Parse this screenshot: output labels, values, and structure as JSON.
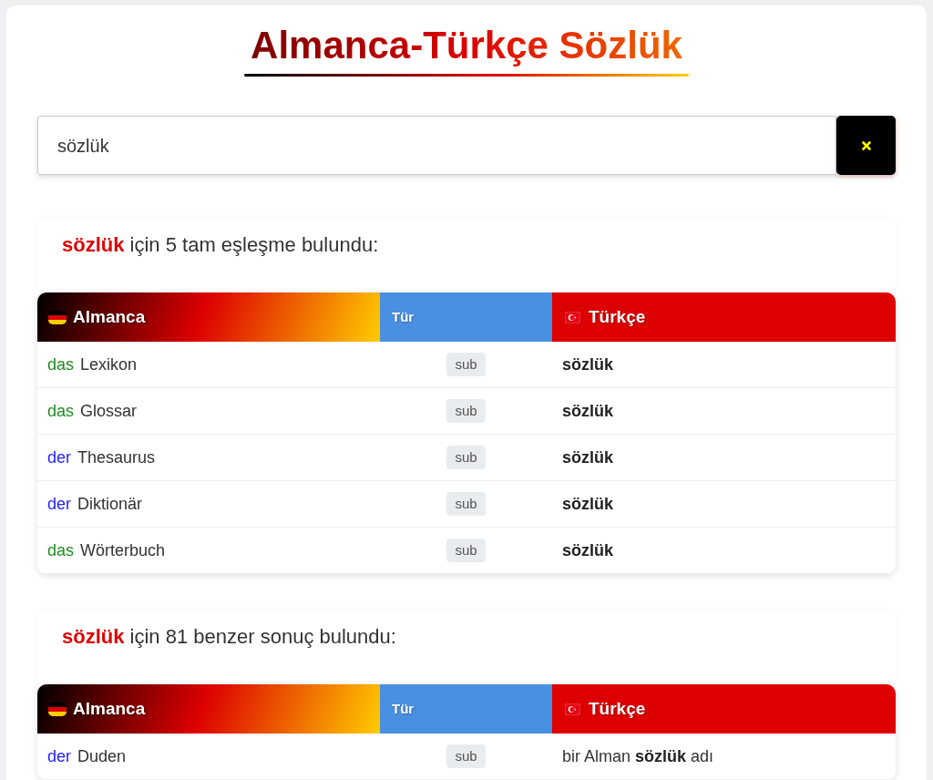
{
  "title": "Almanca-Türkçe Sözlük",
  "search": {
    "value": "sözlük"
  },
  "sections": [
    {
      "kind": "exact",
      "query": "sözlük",
      "summary": "için 5 tam eşleşme bulundu:",
      "columns": [
        {
          "label": "Almanca",
          "kind": "german"
        },
        {
          "label": "Tür",
          "kind": "type"
        },
        {
          "label": "Türkçe",
          "kind": "turkish"
        }
      ],
      "rows": [
        {
          "article": "das",
          "color": "#228b22",
          "word": "Lexikon",
          "type": "sub",
          "translation": "sözlük"
        },
        {
          "article": "das",
          "color": "#228b22",
          "word": "Glossar",
          "type": "sub",
          "translation": "sözlük"
        },
        {
          "article": "der",
          "color": "#2222ff",
          "word": "Thesaurus",
          "type": "sub",
          "translation": "sözlük"
        },
        {
          "article": "der",
          "color": "#2222ff",
          "word": "Diktionär",
          "type": "sub",
          "translation": "sözlük"
        },
        {
          "article": "das",
          "color": "#228b22",
          "word": "Wörterbuch",
          "type": "sub",
          "translation": "sözlük"
        }
      ]
    },
    {
      "kind": "similar",
      "query": "sözlük",
      "summary": "için 81 benzer sonuç bulundu:",
      "columns": [
        {
          "label": "Almanca",
          "kind": "german"
        },
        {
          "label": "Tür",
          "kind": "type"
        },
        {
          "label": "Türkçe",
          "kind": "turkish"
        }
      ],
      "rows": [
        {
          "article": "der",
          "color": "#2222ff",
          "word": "Duden",
          "type": "sub",
          "translation": "bir Alman **sözlük** adı"
        }
      ]
    }
  ]
}
